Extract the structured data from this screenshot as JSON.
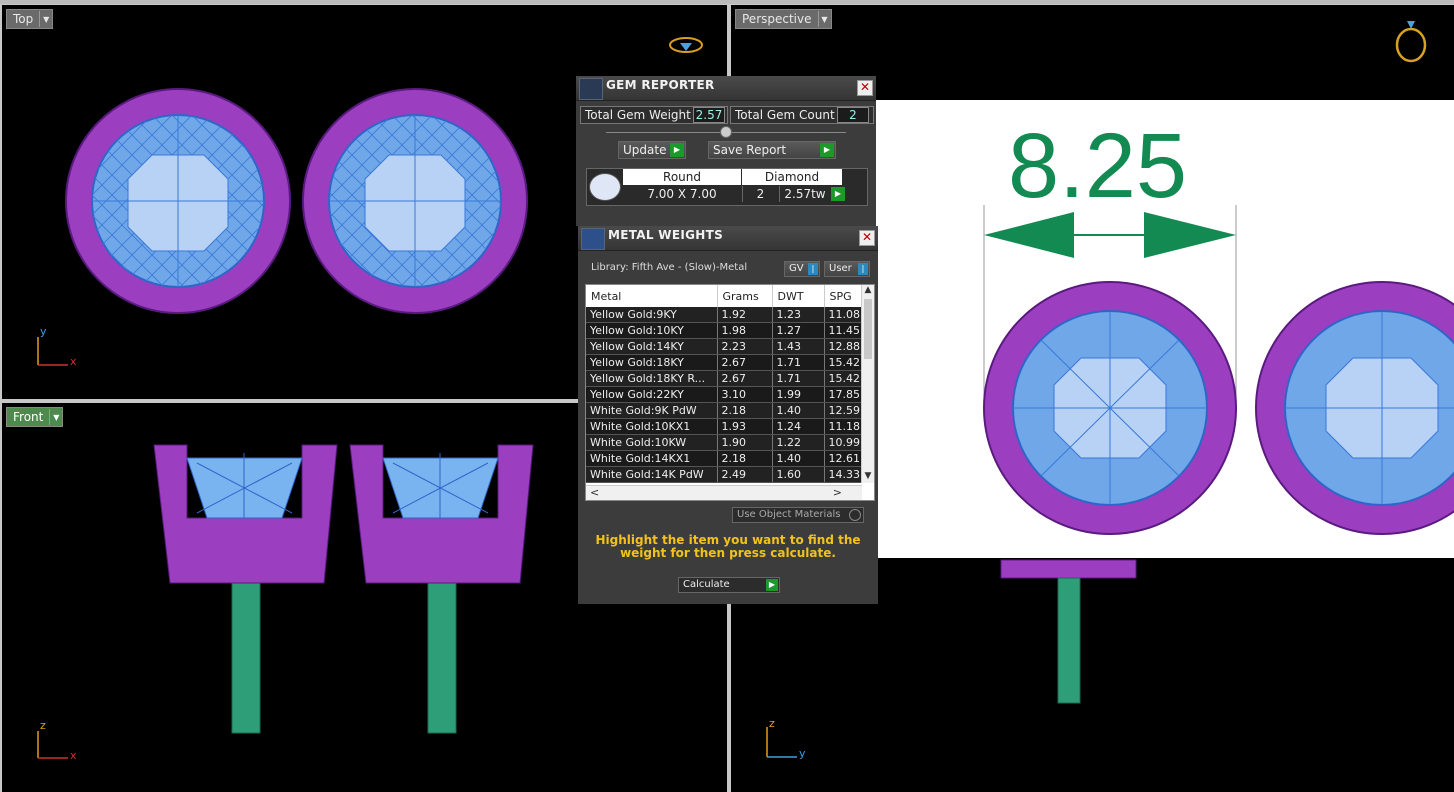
{
  "viewports": {
    "top": {
      "label": "Top",
      "axis_v": "y",
      "axis_h": "x"
    },
    "front": {
      "label": "Front",
      "axis_v": "z",
      "axis_h": "x"
    },
    "perspective": {
      "label": "Perspective",
      "axis_v": "z",
      "axis_h": "y"
    }
  },
  "gem_reporter": {
    "title": "GEM REPORTER",
    "total_weight_label": "Total Gem Weight",
    "total_weight": "2.57",
    "total_count_label": "Total Gem Count",
    "total_count": "2",
    "update_label": "Update",
    "save_report_label": "Save Report",
    "table": {
      "shape": "Round",
      "material": "Diamond",
      "size": "7.00 X 7.00",
      "qty": "2",
      "weight": "2.57tw"
    }
  },
  "metal_weights": {
    "title": "METAL WEIGHTS",
    "library": "Library: Fifth Ave - (Slow)-Metal",
    "gv_label": "GV",
    "user_label": "User",
    "columns": [
      "Metal",
      "Grams",
      "DWT",
      "SPG"
    ],
    "rows": [
      [
        "Yellow Gold:9KY",
        "1.92",
        "1.23",
        "11.08"
      ],
      [
        "Yellow Gold:10KY",
        "1.98",
        "1.27",
        "11.45"
      ],
      [
        "Yellow Gold:14KY",
        "2.23",
        "1.43",
        "12.88"
      ],
      [
        "Yellow Gold:18KY",
        "2.67",
        "1.71",
        "15.42"
      ],
      [
        "Yellow Gold:18KY R...",
        "2.67",
        "1.71",
        "15.42"
      ],
      [
        "Yellow Gold:22KY",
        "3.10",
        "1.99",
        "17.85"
      ],
      [
        "White Gold:9K PdW",
        "2.18",
        "1.40",
        "12.59"
      ],
      [
        "White Gold:10KX1",
        "1.93",
        "1.24",
        "11.18"
      ],
      [
        "White Gold:10KW",
        "1.90",
        "1.22",
        "10.99"
      ],
      [
        "White Gold:14KX1",
        "2.18",
        "1.40",
        "12.61"
      ],
      [
        "White Gold:14K PdW",
        "2.49",
        "1.60",
        "14.33"
      ]
    ],
    "use_object_materials": "Use Object Materials",
    "instruction": "Highlight the item you want to find the weight for then press calculate.",
    "calculate_label": "Calculate"
  },
  "dimension": {
    "value": "8.25"
  },
  "colors": {
    "metal": "#9b3fc0",
    "gem": "#7ab4f0",
    "post": "#2e9e78",
    "dimension": "#138a52",
    "instruction": "#f2c21b"
  }
}
